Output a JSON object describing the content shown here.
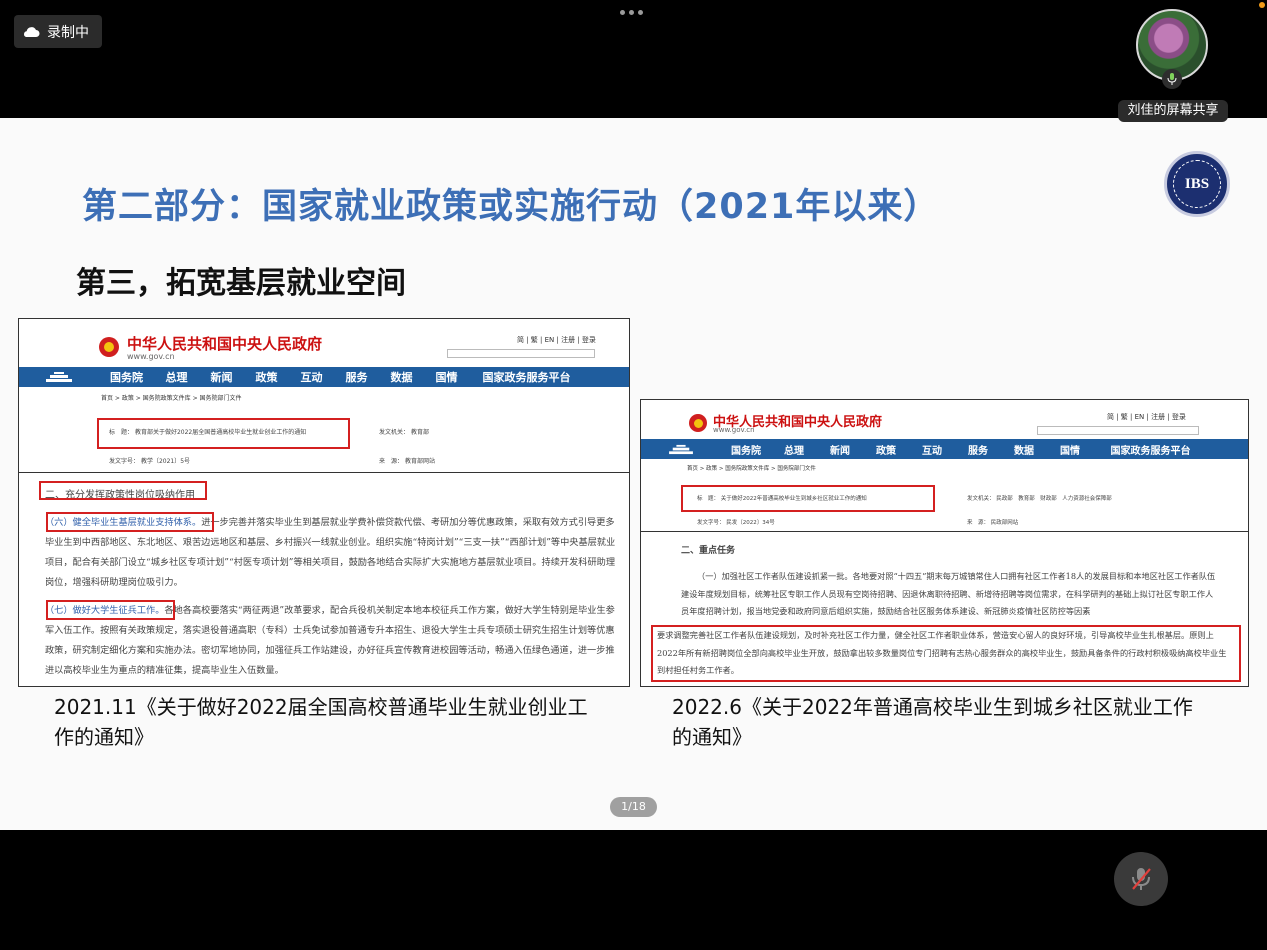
{
  "recording": {
    "label": "录制中"
  },
  "share": {
    "label": "刘佳的屏幕共享"
  },
  "slide": {
    "title": "第二部分：国家就业政策或实施行动（2021年以来）",
    "subtitle": "第三，拓宽基层就业空间",
    "logo_text": "IBS",
    "page_indicator": "1/18"
  },
  "gov_site": {
    "name": "中华人民共和国中央人民政府",
    "url": "www.gov.cn",
    "top_links": "简 | 繁 | EN | 注册 | 登录",
    "nav": [
      "国务院",
      "总理",
      "新闻",
      "政策",
      "互动",
      "服务",
      "数据",
      "国情",
      "国家政务服务平台"
    ],
    "breadcrumb": "首页 > 政策 > 国务院政策文件库 > 国务院部门文件"
  },
  "doc_left": {
    "title_label": "标　题：",
    "title_value": "教育部关于做好2022届全国普通高校毕业生就业创业工作的通知",
    "issuer_label": "发文机关：",
    "issuer_value": "教育部",
    "docno_label": "发文字号：",
    "docno_value": "教学〔2021〕5号",
    "source_label": "来　源：",
    "source_value": "教育部网站",
    "section_heading": "二、充分发挥政策性岗位吸纳作用",
    "para1_lead": "（六）健全毕业生基层就业支持体系。",
    "para1_text": "进一步完善并落实毕业生到基层就业学费补偿贷款代偿、考研加分等优惠政策，采取有效方式引导更多毕业生到中西部地区、东北地区、艰苦边远地区和基层、乡村振兴一线就业创业。组织实施“特岗计划”“三支一扶”“西部计划”等中央基层就业项目，配合有关部门设立“城乡社区专项计划”“村医专项计划”等相关项目，鼓励各地结合实际扩大实施地方基层就业项目。持续开发科研助理岗位，增强科研助理岗位吸引力。",
    "para2_lead": "（七）做好大学生征兵工作。",
    "para2_text": "各地各高校要落实“两征两退”改革要求，配合兵役机关制定本地本校征兵工作方案，做好大学生特别是毕业生参军入伍工作。按照有关政策规定，落实退役普通高职（专科）士兵免试参加普通专升本招生、退役大学生士兵专项硕士研究生招生计划等优惠政策，研究制定细化方案和实施办法。密切军地协同，加强征兵工作站建设，办好征兵宣传教育进校园等活动，畅通入伍绿色通道，进一步推进以高校毕业生为重点的精准征集，提高毕业生入伍数量。"
  },
  "doc_right": {
    "title_label": "标　题：",
    "title_value": "关于做好2022年普通高校毕业生到城乡社区就业工作的通知",
    "issuer_label": "发文机关：",
    "issuer_value": "民政部　教育部　财政部　人力资源社会保障部",
    "docno_label": "发文字号：",
    "docno_value": "民发〔2022〕34号",
    "source_label": "来　源：",
    "source_value": "民政部网站",
    "section_heading": "二、重点任务",
    "para_text_a": "（一）加强社区工作者队伍建设抓紧一批。各地要对照“十四五”期末每万城镇常住人口拥有社区工作者18人的发展目标和本地区社区工作者队伍建设年度规划目标，统筹社区专职工作人员现有空岗待招聘、因退休离职待招聘、新增待招聘等岗位需求，在科学研判的基础上拟订社区专职工作人员年度招聘计划，报当地党委和政府同意后组织实施，鼓励结合社区服务体系建设、新冠肺炎疫情社区防控等因素",
    "para_text_b": "要求调整完善社区工作者队伍建设规划，及时补充社区工作力量，健全社区工作者职业体系，营造安心留人的良好环境，引导高校毕业生扎根基层。原则上2022年所有新招聘岗位全部向高校毕业生开放，鼓励拿出较多数量岗位专门招聘有志热心服务群众的高校毕业生，鼓励具备条件的行政村积极吸纳高校毕业生到村担任村务工作者。"
  },
  "captions": {
    "left": "2021.11《关于做好2022届全国高校普通毕业生就业创业工作的通知》",
    "right": "2022.6《关于2022年普通高校毕业生到城乡社区就业工作的通知》"
  }
}
